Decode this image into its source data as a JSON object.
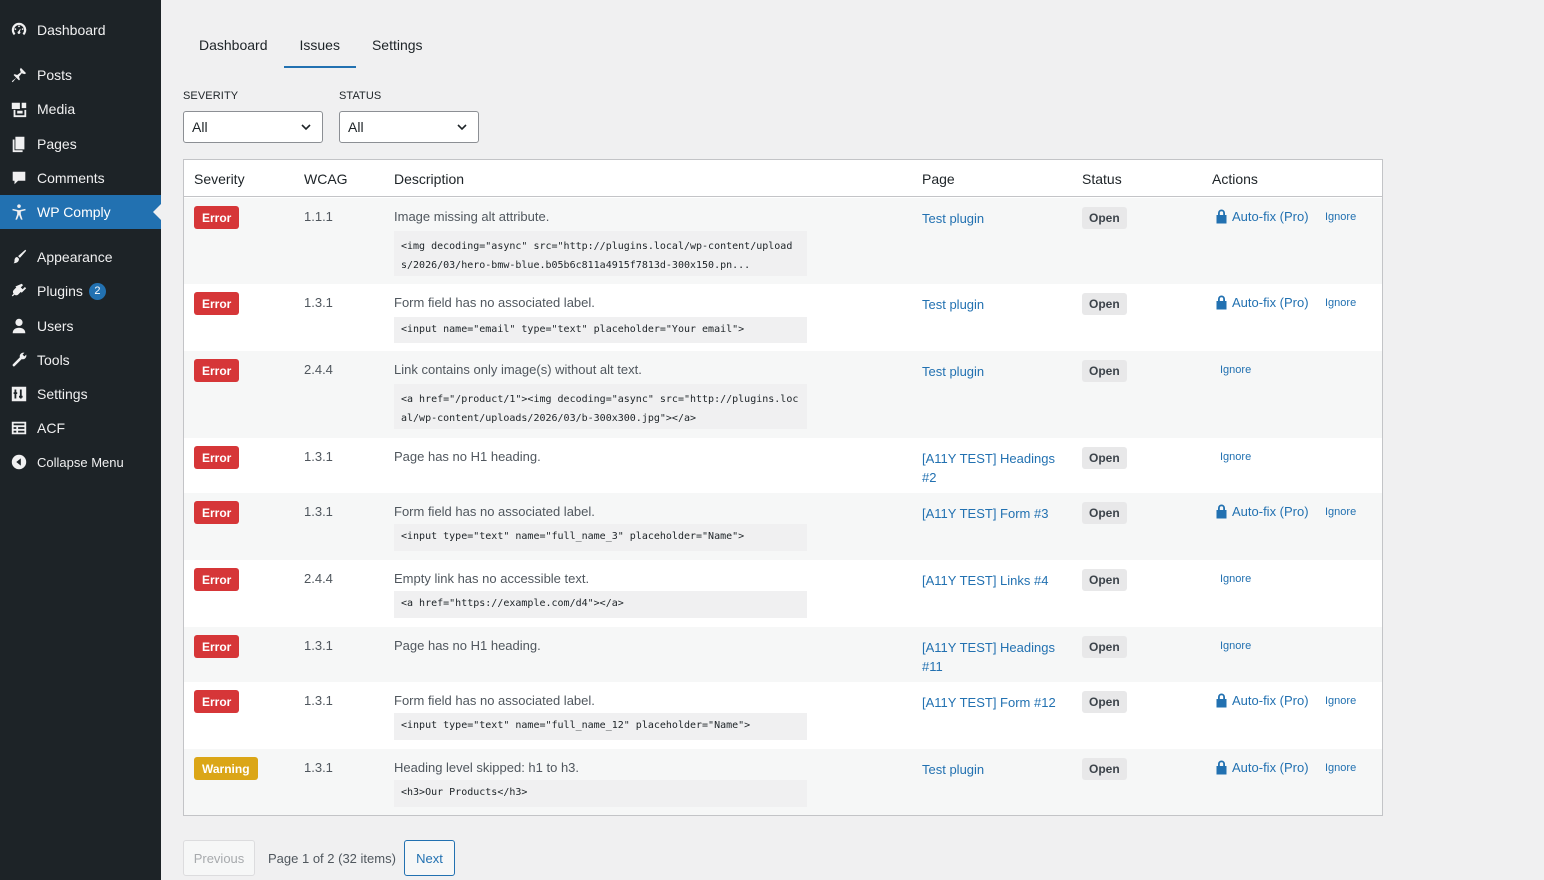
{
  "sidebar": {
    "items": [
      {
        "label": "Dashboard",
        "icon": "dashboard-icon"
      },
      {
        "label": "Posts",
        "icon": "pin-icon"
      },
      {
        "label": "Media",
        "icon": "media-icon"
      },
      {
        "label": "Pages",
        "icon": "pages-icon"
      },
      {
        "label": "Comments",
        "icon": "comments-icon"
      },
      {
        "label": "WP Comply",
        "icon": "accessibility-icon",
        "active": true
      },
      {
        "label": "Appearance",
        "icon": "brush-icon"
      },
      {
        "label": "Plugins",
        "icon": "plugin-icon",
        "badge": "2"
      },
      {
        "label": "Users",
        "icon": "user-icon"
      },
      {
        "label": "Tools",
        "icon": "wrench-icon"
      },
      {
        "label": "Settings",
        "icon": "settings-icon"
      },
      {
        "label": "ACF",
        "icon": "acf-icon"
      },
      {
        "label": "Collapse Menu",
        "icon": "collapse-icon"
      }
    ]
  },
  "tabs": [
    {
      "label": "Dashboard"
    },
    {
      "label": "Issues",
      "active": true
    },
    {
      "label": "Settings"
    }
  ],
  "filters": {
    "severity": {
      "label": "SEVERITY",
      "value": "All"
    },
    "status": {
      "label": "STATUS",
      "value": "All"
    }
  },
  "table": {
    "headers": {
      "severity": "Severity",
      "wcag": "WCAG",
      "description": "Description",
      "page": "Page",
      "status": "Status",
      "actions": "Actions"
    },
    "autofix_label": "Auto-fix (Pro)",
    "ignore_label": "Ignore",
    "rows": [
      {
        "severity": "Error",
        "wcag": "1.1.1",
        "description": "Image missing alt attribute.",
        "code": "<img decoding=\"async\" src=\"http://plugins.local/wp-content/uploads/2026/03/hero-bmw-blue.b05b6c811a4915f7813d-300x150.pn...",
        "page": "Test plugin",
        "status": "Open",
        "autofix": true
      },
      {
        "severity": "Error",
        "wcag": "1.3.1",
        "description": "Form field has no associated label.",
        "code": "<input name=\"email\" type=\"text\" placeholder=\"Your email\">",
        "page": "Test plugin",
        "status": "Open",
        "autofix": true
      },
      {
        "severity": "Error",
        "wcag": "2.4.4",
        "description": "Link contains only image(s) without alt text.",
        "code": "<a href=\"/product/1\"><img decoding=\"async\" src=\"http://plugins.local/wp-content/uploads/2026/03/b-300x300.jpg\"></a>",
        "page": "Test plugin",
        "status": "Open",
        "autofix": false
      },
      {
        "severity": "Error",
        "wcag": "1.3.1",
        "description": "Page has no H1 heading.",
        "code": "",
        "page": "[A11Y TEST] Headings #2",
        "status": "Open",
        "autofix": false
      },
      {
        "severity": "Error",
        "wcag": "1.3.1",
        "description": "Form field has no associated label.",
        "code": "<input type=\"text\" name=\"full_name_3\" placeholder=\"Name\">",
        "page": "[A11Y TEST] Form #3",
        "status": "Open",
        "autofix": true
      },
      {
        "severity": "Error",
        "wcag": "2.4.4",
        "description": "Empty link has no accessible text.",
        "code": "<a href=\"https://example.com/d4\"></a>",
        "page": "[A11Y TEST] Links #4",
        "status": "Open",
        "autofix": false
      },
      {
        "severity": "Error",
        "wcag": "1.3.1",
        "description": "Page has no H1 heading.",
        "code": "",
        "page": "[A11Y TEST] Headings #11",
        "status": "Open",
        "autofix": false
      },
      {
        "severity": "Error",
        "wcag": "1.3.1",
        "description": "Form field has no associated label.",
        "code": "<input type=\"text\" name=\"full_name_12\" placeholder=\"Name\">",
        "page": "[A11Y TEST] Form #12",
        "status": "Open",
        "autofix": true
      },
      {
        "severity": "Warning",
        "wcag": "1.3.1",
        "description": "Heading level skipped: h1 to h3.",
        "code": "<h3>Our Products</h3>",
        "page": "Test plugin",
        "status": "Open",
        "autofix": true
      }
    ]
  },
  "pagination": {
    "previous": "Previous",
    "info": "Page 1 of 2 (32 items)",
    "next": "Next"
  }
}
